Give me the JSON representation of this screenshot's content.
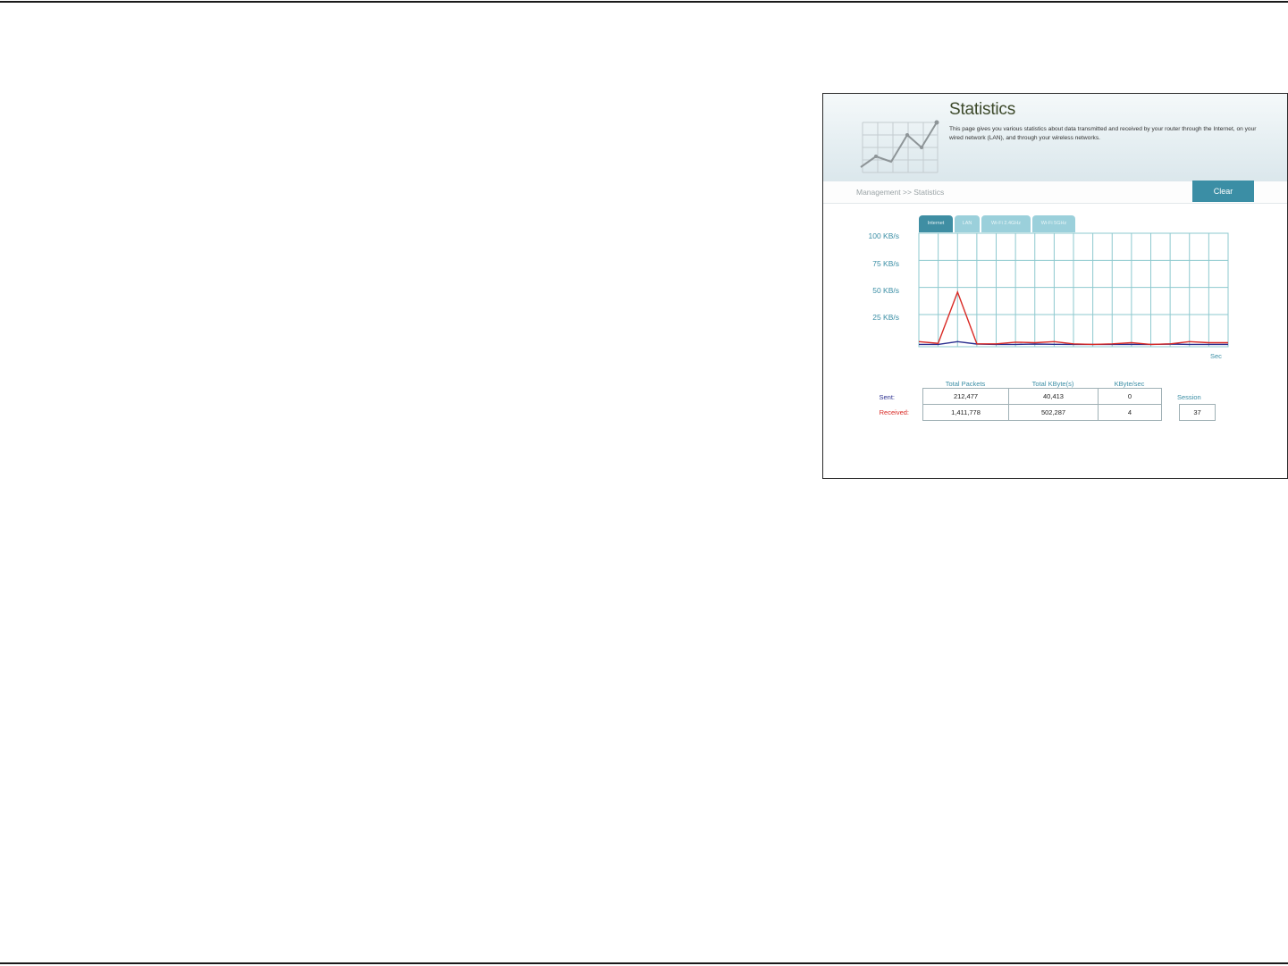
{
  "page": {
    "title": "Statistics",
    "description": "This page gives you various statistics about data transmitted and received by your router through the Internet, on your wired network (LAN), and through your wireless networks.",
    "breadcrumb": "Management >> Statistics",
    "clear_label": "Clear"
  },
  "tabs": [
    {
      "label": "Internet",
      "active": true
    },
    {
      "label": "LAN",
      "active": false
    },
    {
      "label": "Wi-Fi 2.4GHz",
      "active": false
    },
    {
      "label": "Wi-Fi 5GHz",
      "active": false
    }
  ],
  "chart_data": {
    "type": "line",
    "y_ticks": [
      "100 KB/s",
      "75 KB/s",
      "50 KB/s",
      "25 KB/s"
    ],
    "xlabel": "Sec",
    "ylim": [
      0,
      100
    ],
    "series": [
      {
        "name": "Sent",
        "color": "#2b2f8f",
        "values": [
          0.5,
          0.5,
          3,
          0.8,
          0.5,
          0.5,
          0.8,
          0.6,
          0.5,
          0.5,
          0.5,
          0.5,
          0.5,
          0.8,
          0.5,
          0.5,
          0.5
        ]
      },
      {
        "name": "Received",
        "color": "#d92a25",
        "values": [
          3,
          1.5,
          48,
          1,
          1,
          2.5,
          2,
          3,
          1,
          0.5,
          1,
          2,
          0.5,
          1,
          3,
          2,
          2
        ]
      }
    ],
    "grid": true
  },
  "stats": {
    "columns": [
      "Total Packets",
      "Total KByte(s)",
      "KByte/sec"
    ],
    "rows": [
      {
        "label": "Sent:",
        "values": [
          "212,477",
          "40,413",
          "0"
        ]
      },
      {
        "label": "Received:",
        "values": [
          "1,411,778",
          "502,287",
          "4"
        ]
      }
    ],
    "session_label": "Session",
    "session_value": "37"
  },
  "colors": {
    "accent": "#3b8ea5",
    "tab_inactive": "#9bd0db",
    "sent": "#2b2f8f",
    "received": "#d92a25"
  }
}
